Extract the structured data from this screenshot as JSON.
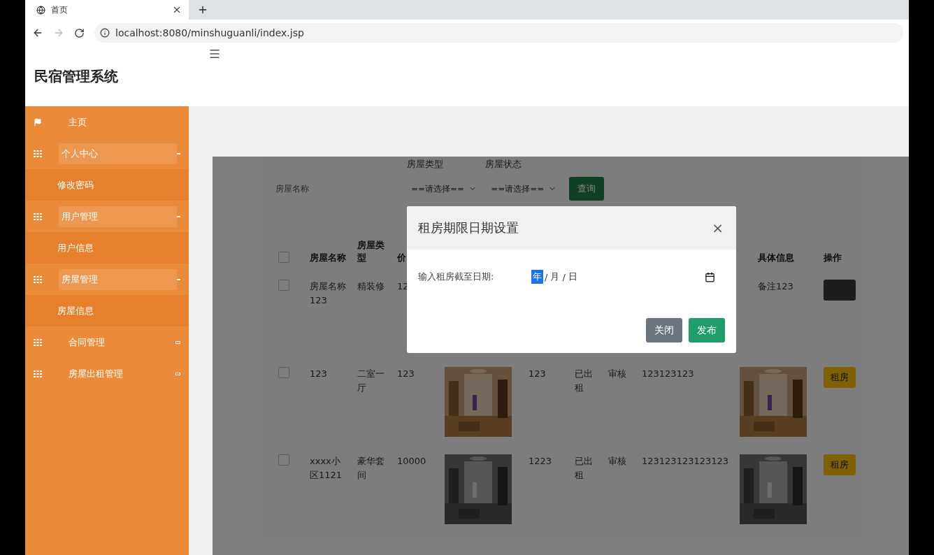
{
  "browser": {
    "tab_title": "首页",
    "url": "localhost:8080/minshuguanli/index.jsp"
  },
  "header": {
    "title": "民宿管理系统"
  },
  "sidebar": {
    "items": [
      {
        "kind": "link",
        "label": "主页"
      },
      {
        "kind": "group",
        "label": "个人中心",
        "expanded": true,
        "children": [
          {
            "label": "修改密码"
          }
        ]
      },
      {
        "kind": "group",
        "label": "用户管理",
        "expanded": true,
        "children": [
          {
            "label": "用户信息"
          }
        ]
      },
      {
        "kind": "group",
        "label": "房屋管理",
        "expanded": true,
        "children": [
          {
            "label": "房屋信息"
          }
        ]
      },
      {
        "kind": "group",
        "label": "合同管理",
        "expanded": false
      },
      {
        "kind": "group",
        "label": "房屋出租管理",
        "expanded": false
      }
    ]
  },
  "search": {
    "labels": [
      "房屋类型",
      "房屋状态"
    ],
    "name_placeholder": "房屋名称",
    "selects": [
      "==请选择==",
      "==请选择=="
    ],
    "button": "查询"
  },
  "table": {
    "select_all_checked": false,
    "columns": [
      {
        "label": "房屋名称"
      },
      {
        "label": "房屋类型"
      },
      {
        "label": "价"
      },
      {},
      {},
      {},
      {},
      {},
      {
        "label": "具体信息"
      },
      {
        "label": "操作"
      }
    ],
    "rows": [
      {
        "checked": false,
        "cells": [
          {
            "kind": "text",
            "text": "房屋名称123"
          },
          {
            "kind": "text",
            "text": "精装修"
          },
          {
            "kind": "text",
            "text": "12"
          },
          {
            "kind": "empty"
          },
          {
            "kind": "empty"
          },
          {
            "kind": "empty"
          },
          {
            "kind": "empty"
          },
          {
            "kind": "empty"
          },
          {
            "kind": "text",
            "text": "备注123"
          },
          {
            "kind": "dark-button"
          }
        ]
      },
      {
        "checked": false,
        "cells": [
          {
            "kind": "text",
            "text": "123"
          },
          {
            "kind": "text",
            "text": "二室一厅"
          },
          {
            "kind": "text",
            "text": "123"
          },
          {
            "kind": "picture"
          },
          {
            "kind": "text",
            "text": "123"
          },
          {
            "kind": "text",
            "text": "已出租"
          },
          {
            "kind": "text",
            "text": "审核"
          },
          {
            "kind": "text",
            "text": "123123123"
          },
          {
            "kind": "picture"
          },
          {
            "kind": "button",
            "text": "租房"
          }
        ]
      },
      {
        "checked": false,
        "cells": [
          {
            "kind": "text",
            "text": "xxxx小区1121"
          },
          {
            "kind": "text",
            "text": "豪华套间"
          },
          {
            "kind": "text",
            "text": "10000"
          },
          {
            "kind": "picture"
          },
          {
            "kind": "text",
            "text": "1223"
          },
          {
            "kind": "text",
            "text": "已出租"
          },
          {
            "kind": "text",
            "text": "审核"
          },
          {
            "kind": "text",
            "text": "123123123123123"
          },
          {
            "kind": "picture"
          },
          {
            "kind": "button",
            "text": "租房"
          }
        ]
      }
    ]
  },
  "modal": {
    "title": "租房期限日期设置",
    "close": "×",
    "label": "输入租房截至日期:",
    "date_segments": [
      {
        "text": "年",
        "selected": true
      },
      {
        "text": "/",
        "selected": false
      },
      {
        "text": "月",
        "selected": false
      },
      {
        "text": "/",
        "selected": false
      },
      {
        "text": "日",
        "selected": false
      }
    ],
    "buttons": [
      {
        "kind": "secondary",
        "label": "关闭"
      },
      {
        "kind": "primary",
        "label": "发布"
      }
    ]
  }
}
